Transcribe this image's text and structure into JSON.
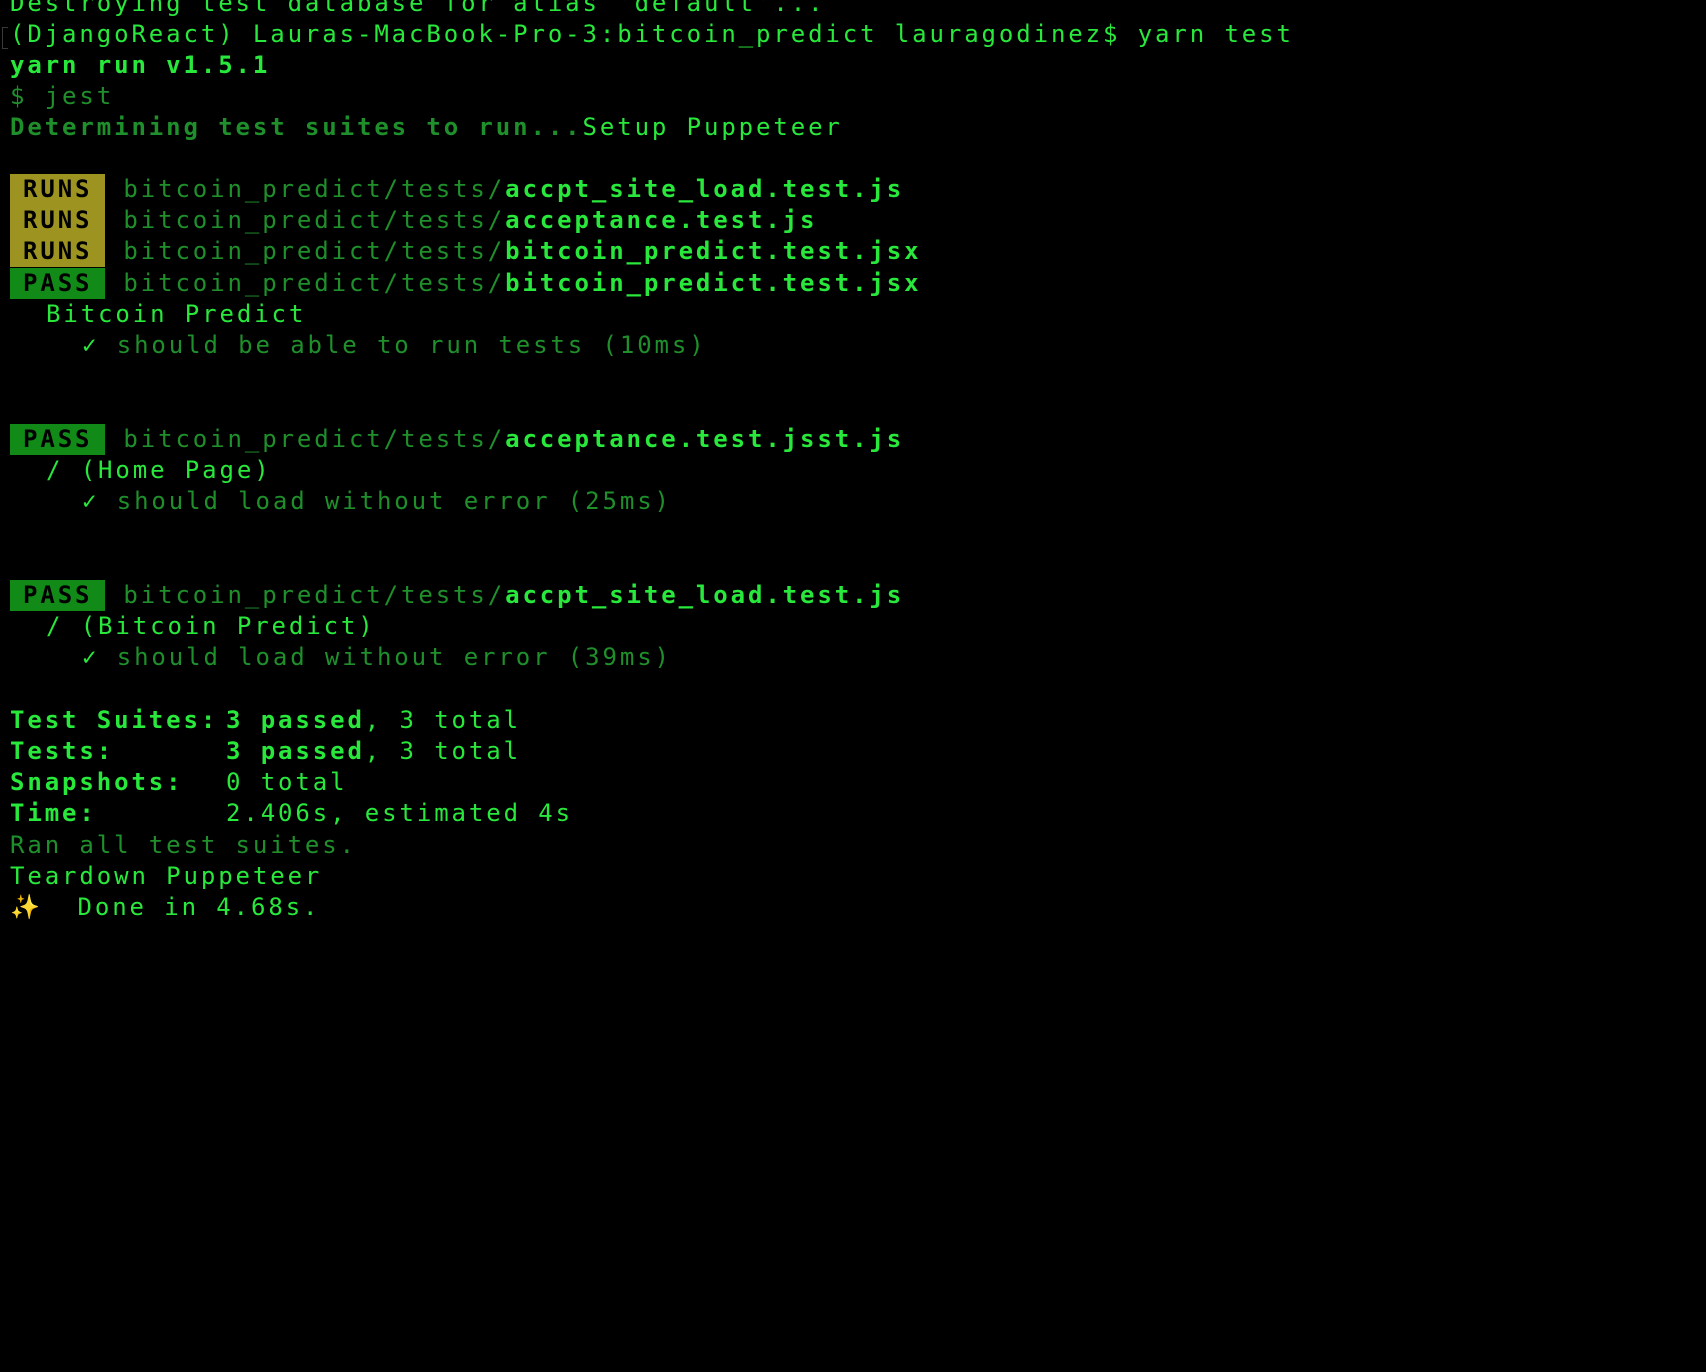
{
  "terminal": {
    "top_line": "Destroying test database for alias 'default'...",
    "prompt": "(DjangoReact) Lauras-MacBook-Pro-3:bitcoin_predict lauragodinez$ yarn test",
    "yarn_version": "yarn run v1.5.1",
    "jest_cmd": "$ jest",
    "determining": "Determining test suites to run...",
    "setup": "Setup Puppeteer",
    "runs_label": "RUNS",
    "pass_label": "PASS",
    "path_prefix": "bitcoin_predict/tests/",
    "runs": [
      {
        "file": "accpt_site_load.test.js"
      },
      {
        "file": "acceptance.test.js"
      },
      {
        "file": "bitcoin_predict.test.jsx"
      }
    ],
    "results": [
      {
        "file": "bitcoin_predict.test.jsx",
        "describe": "Bitcoin Predict",
        "check": "✓",
        "test": "should be able to run tests (10ms)"
      },
      {
        "file": "acceptance.test.jsst.js",
        "describe": "/ (Home Page)",
        "check": "✓",
        "test": "should load without error (25ms)"
      },
      {
        "file": "accpt_site_load.test.js",
        "describe": "/ (Bitcoin Predict)",
        "check": "✓",
        "test": "should load without error (39ms)"
      }
    ],
    "summary": {
      "suites_label": "Test Suites:",
      "suites_passed": "3 passed",
      "suites_total": ", 3 total",
      "tests_label": "Tests:",
      "tests_passed": "3 passed",
      "tests_total": ", 3 total",
      "snapshots_label": "Snapshots:",
      "snapshots_value": "0 total",
      "time_label": "Time:",
      "time_value": "2.406s, estimated 4s"
    },
    "ran_all": "Ran all test suites.",
    "teardown": "Teardown Puppeteer",
    "sparkles": "✨",
    "done": "Done in 4.68s."
  },
  "colors": {
    "background": "#000000",
    "text_green": "#29e83c",
    "dim_green": "#1f8f2b",
    "runs_badge": "#9c9320",
    "pass_badge": "#128a18"
  }
}
